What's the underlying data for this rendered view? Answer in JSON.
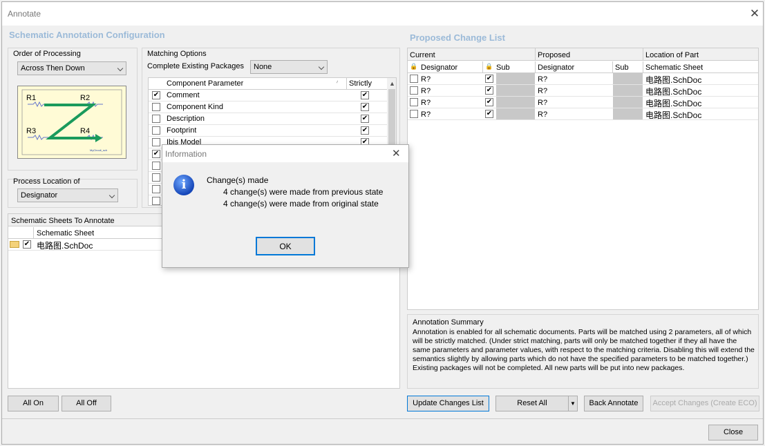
{
  "window": {
    "title": "Annotate",
    "close": "✕"
  },
  "left": {
    "section_title": "Schematic Annotation Configuration",
    "order": {
      "label": "Order of Processing",
      "value": "Across Then Down"
    },
    "preview": {
      "r1": "R1",
      "r2": "R2",
      "r3": "R3",
      "r4": "R4",
      "caption": "MyCircuit_sch"
    },
    "process_location": {
      "label": "Process Location of",
      "value": "Designator"
    },
    "matching": {
      "label": "Matching Options",
      "complete_label": "Complete Existing Packages",
      "complete_value": "None",
      "col_param": "Component Parameter",
      "col_strict": "Strictly",
      "rows": [
        {
          "name": "Comment",
          "checked": "✔",
          "strict": "✔"
        },
        {
          "name": "Component Kind",
          "checked": "",
          "strict": "✔"
        },
        {
          "name": "Description",
          "checked": "",
          "strict": "✔"
        },
        {
          "name": "Footprint",
          "checked": "",
          "strict": "✔"
        },
        {
          "name": "Ibis Model",
          "checked": "",
          "strict": "✔"
        }
      ],
      "extra_checks": [
        "✔",
        "",
        "",
        "",
        ""
      ]
    },
    "sheets": {
      "label": "Schematic Sheets To Annotate",
      "col_sheet": "Schematic Sheet",
      "rows": [
        {
          "checked": "✔",
          "name": "电路图.SchDoc"
        }
      ]
    },
    "buttons": {
      "all_on": "All On",
      "all_off": "All Off"
    }
  },
  "right": {
    "section_title": "Proposed Change List",
    "headers": {
      "current": "Current",
      "proposed": "Proposed",
      "location": "Location of Part",
      "designator": "Designator",
      "sub": "Sub",
      "p_designator": "Designator",
      "p_sub": "Sub",
      "schematic_sheet": "Schematic Sheet"
    },
    "rows": [
      {
        "cur": "R?",
        "sub": "✔",
        "prop": "R?",
        "sheet": "电路图.SchDoc"
      },
      {
        "cur": "R?",
        "sub": "✔",
        "prop": "R?",
        "sheet": "电路图.SchDoc"
      },
      {
        "cur": "R?",
        "sub": "✔",
        "prop": "R?",
        "sheet": "电路图.SchDoc"
      },
      {
        "cur": "R?",
        "sub": "✔",
        "prop": "R?",
        "sheet": "电路图.SchDoc"
      }
    ],
    "summary": {
      "label": "Annotation Summary",
      "text": "Annotation is enabled for all schematic documents. Parts will be matched using 2 parameters, all of which will be strictly matched. (Under strict matching, parts will only be matched together if they all have the same parameters and parameter values, with respect to the matching criteria. Disabling this will extend the semantics slightly by allowing parts which do not have the specified parameters to be matched together.) Existing packages will not be completed. All new parts will be put into new packages."
    },
    "buttons": {
      "update": "Update Changes List",
      "reset": "Reset All",
      "back": "Back Annotate",
      "accept": "Accept Changes (Create ECO)"
    }
  },
  "footer": {
    "close": "Close"
  },
  "dialog": {
    "title": "Information",
    "close": "✕",
    "icon": "i",
    "heading": "Change(s) made",
    "line1": "4 change(s) were made from previous state",
    "line2": "4 change(s) were made from original state",
    "ok": "OK"
  }
}
